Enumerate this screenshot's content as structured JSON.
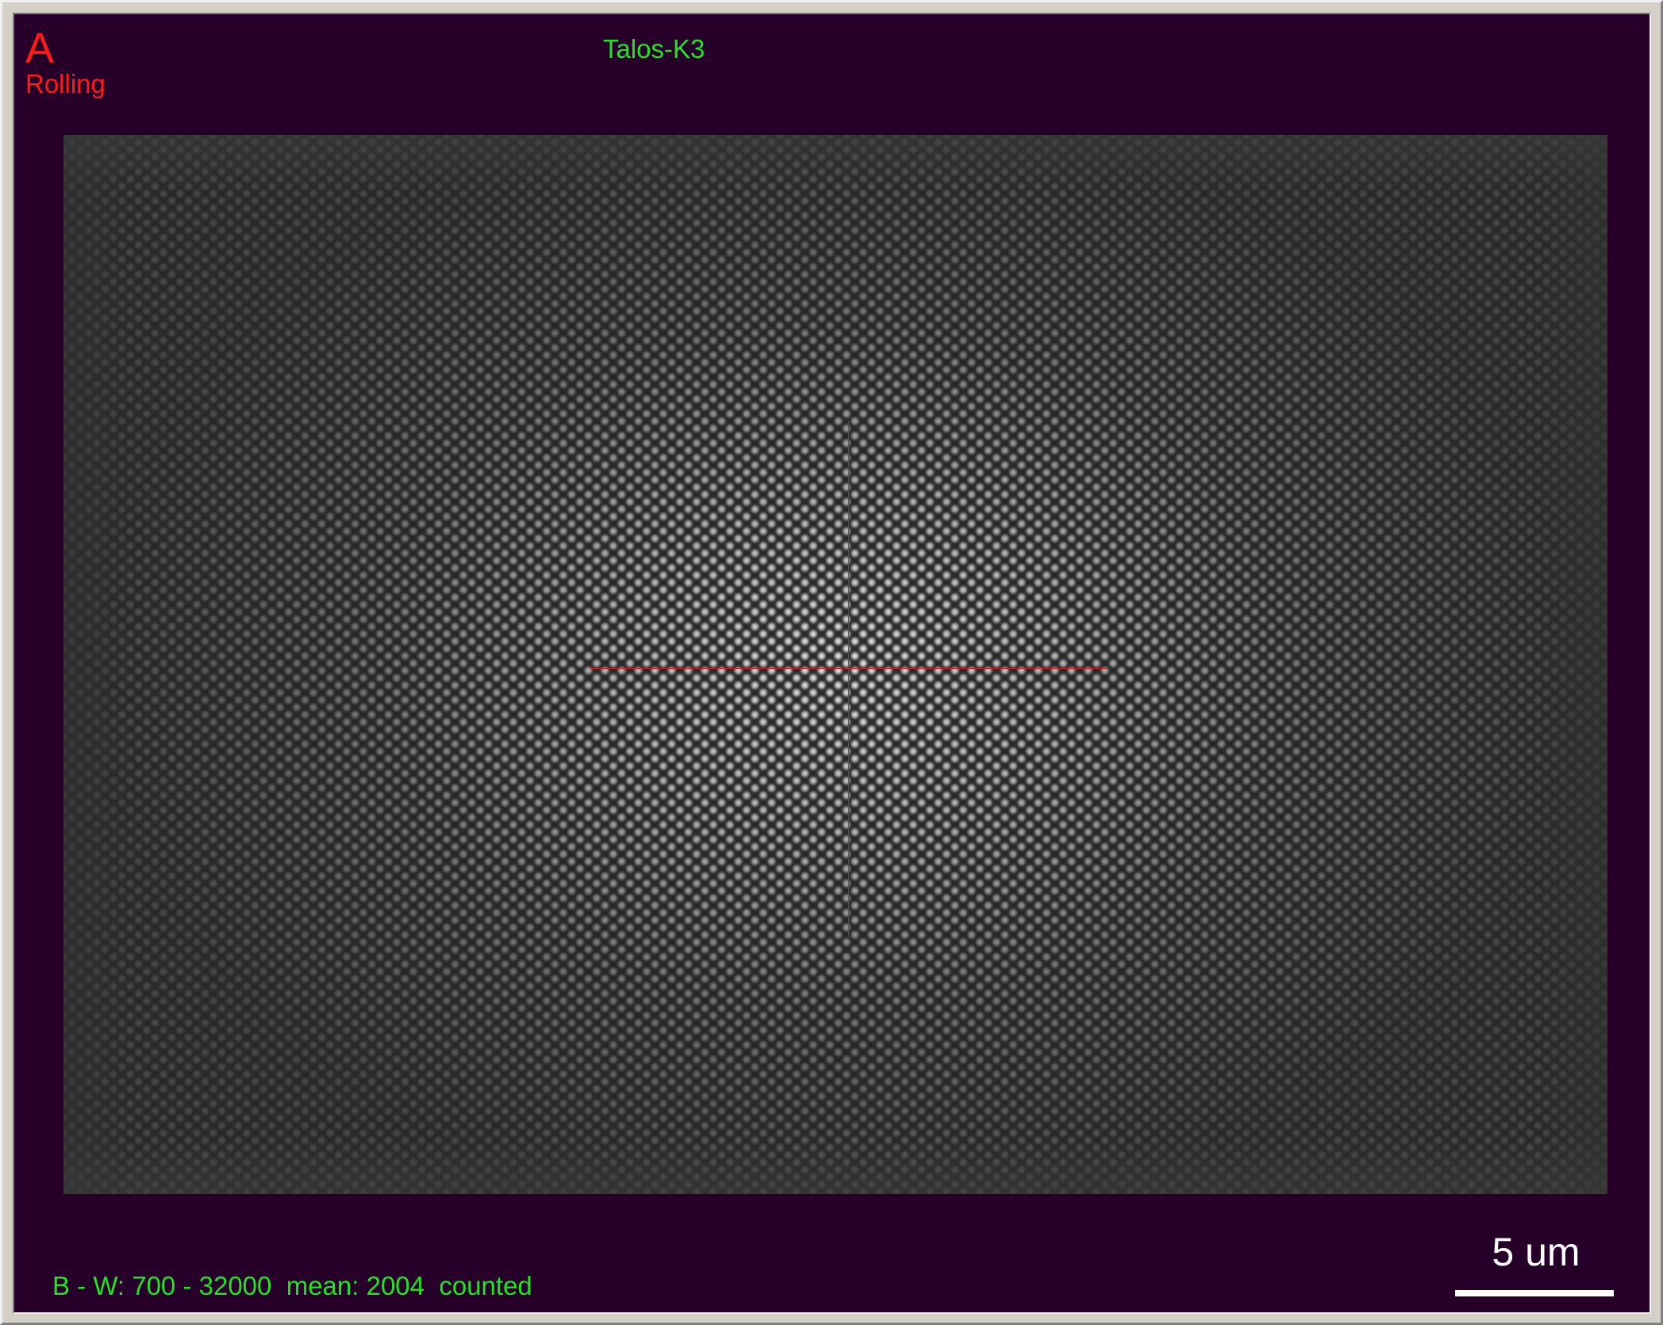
{
  "overlay": {
    "buffer_letter": "A",
    "acquire_mode": "Rolling",
    "camera_name": "Talos-K3",
    "stats": {
      "text": "B - W: 700 - 32000  mean: 2004  counted",
      "black": 700,
      "white": 32000,
      "mean": 2004,
      "mode": "counted"
    },
    "scale_bar": {
      "label": "5 um",
      "length_um": 5
    }
  },
  "colors": {
    "viewport_background": "#27002a",
    "status_text": "#1fe61f",
    "buffer_text": "#ff1a1a",
    "crosshair": "#d81a1a",
    "scale_bar": "#ffffff"
  },
  "image": {
    "content": "hexagonal hole lattice",
    "crosshair": true
  }
}
